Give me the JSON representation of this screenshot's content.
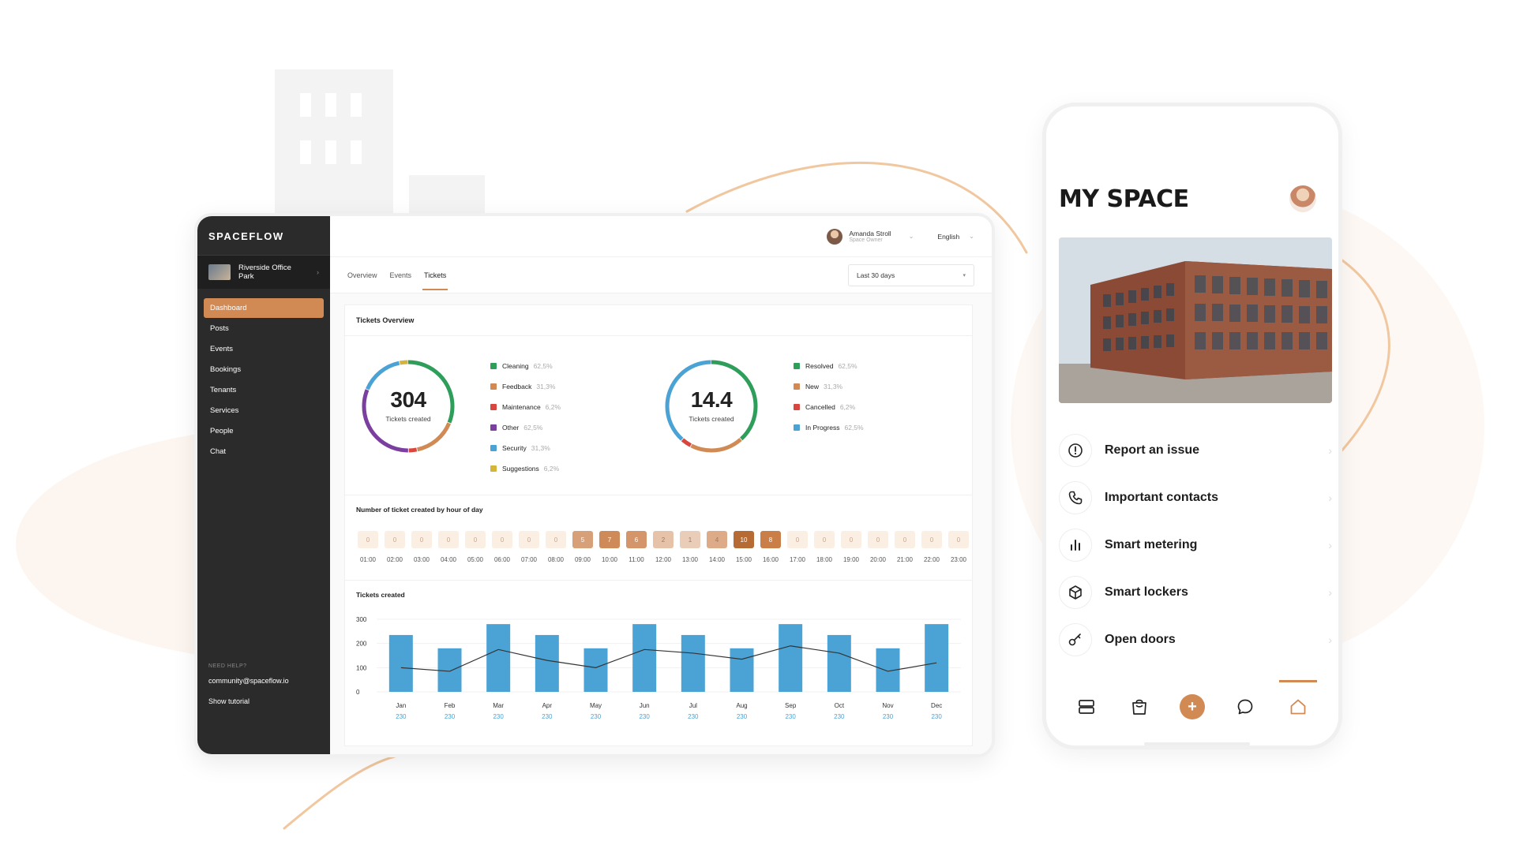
{
  "dashboard": {
    "brand": "SPACEFLOW",
    "property": "Riverside Office Park",
    "nav": [
      {
        "label": "Dashboard",
        "active": true
      },
      {
        "label": "Posts"
      },
      {
        "label": "Events"
      },
      {
        "label": "Bookings"
      },
      {
        "label": "Tenants"
      },
      {
        "label": "Services"
      },
      {
        "label": "People"
      },
      {
        "label": "Chat"
      }
    ],
    "help": {
      "label": "NEED HELP?",
      "email": "community@spaceflow.io",
      "tutorial": "Show tutorial"
    },
    "user": {
      "name": "Amanda Stroll",
      "role": "Space Owner"
    },
    "language": "English",
    "tabs": [
      "Overview",
      "Events",
      "Tickets"
    ],
    "active_tab": "Tickets",
    "date_range": "Last 30 days",
    "card_title": "Tickets Overview",
    "donut1": {
      "value": "304",
      "label": "Tickets created"
    },
    "donut2": {
      "value": "14.4",
      "label": "Tickets created"
    },
    "legend1": [
      {
        "label": "Cleaning",
        "pct": "62,5%",
        "color": "#2f9e5b"
      },
      {
        "label": "Feedback",
        "pct": "31,3%",
        "color": "#d28a54"
      },
      {
        "label": "Maintenance",
        "pct": "6,2%",
        "color": "#d9463e"
      },
      {
        "label": "Other",
        "pct": "62,5%",
        "color": "#7b3fa0"
      },
      {
        "label": "Security",
        "pct": "31,3%",
        "color": "#4aa3d4"
      },
      {
        "label": "Suggestions",
        "pct": "6,2%",
        "color": "#d4b43a"
      }
    ],
    "legend2": [
      {
        "label": "Resolved",
        "pct": "62,5%",
        "color": "#2f9e5b"
      },
      {
        "label": "New",
        "pct": "31,3%",
        "color": "#d28a54"
      },
      {
        "label": "Cancelled",
        "pct": "6,2%",
        "color": "#d9463e"
      },
      {
        "label": "In Progress",
        "pct": "62,5%",
        "color": "#4aa3d4"
      }
    ],
    "hours_title": "Number of ticket created by hour of day",
    "hours": [
      {
        "h": "01:00",
        "v": "0"
      },
      {
        "h": "02:00",
        "v": "0"
      },
      {
        "h": "03:00",
        "v": "0"
      },
      {
        "h": "04:00",
        "v": "0"
      },
      {
        "h": "05:00",
        "v": "0"
      },
      {
        "h": "06:00",
        "v": "0"
      },
      {
        "h": "07:00",
        "v": "0"
      },
      {
        "h": "08:00",
        "v": "0"
      },
      {
        "h": "09:00",
        "v": "5"
      },
      {
        "h": "10:00",
        "v": "7"
      },
      {
        "h": "11:00",
        "v": "6"
      },
      {
        "h": "12:00",
        "v": "2"
      },
      {
        "h": "13:00",
        "v": "1"
      },
      {
        "h": "14:00",
        "v": "4"
      },
      {
        "h": "15:00",
        "v": "10"
      },
      {
        "h": "16:00",
        "v": "8"
      },
      {
        "h": "17:00",
        "v": "0"
      },
      {
        "h": "18:00",
        "v": "0"
      },
      {
        "h": "19:00",
        "v": "0"
      },
      {
        "h": "20:00",
        "v": "0"
      },
      {
        "h": "21:00",
        "v": "0"
      },
      {
        "h": "22:00",
        "v": "0"
      },
      {
        "h": "23:00",
        "v": "0"
      }
    ],
    "bar_title": "Tickets created"
  },
  "chart_data": {
    "type": "bar",
    "title": "Tickets created",
    "categories": [
      "Jan",
      "Feb",
      "Mar",
      "Apr",
      "May",
      "Jun",
      "Jul",
      "Aug",
      "Sep",
      "Oct",
      "Nov",
      "Dec"
    ],
    "sublabels": [
      "230",
      "230",
      "230",
      "230",
      "230",
      "230",
      "230",
      "230",
      "230",
      "230",
      "230",
      "230"
    ],
    "series": [
      {
        "type": "bar",
        "values": [
          235,
          180,
          280,
          235,
          180,
          280,
          235,
          180,
          280,
          235,
          180,
          280
        ],
        "color": "#4aa3d4"
      },
      {
        "type": "line",
        "values": [
          100,
          85,
          175,
          130,
          100,
          175,
          160,
          135,
          190,
          160,
          85,
          120
        ],
        "color": "#333333"
      }
    ],
    "yticks": [
      "300",
      "200",
      "100",
      "0"
    ],
    "ylim": [
      0,
      300
    ]
  },
  "phone": {
    "title": "MY SPACE",
    "menu": [
      {
        "label": "Report an issue",
        "icon": "alert-circle-icon"
      },
      {
        "label": "Important contacts",
        "icon": "phone-icon"
      },
      {
        "label": "Smart metering",
        "icon": "bar-chart-icon"
      },
      {
        "label": "Smart lockers",
        "icon": "package-icon"
      },
      {
        "label": "Open doors",
        "icon": "key-icon"
      }
    ],
    "tabbar": [
      "feed-icon",
      "shopping-bag-icon",
      "plus-icon",
      "chat-icon",
      "home-icon"
    ],
    "accent": "#d28a54"
  }
}
